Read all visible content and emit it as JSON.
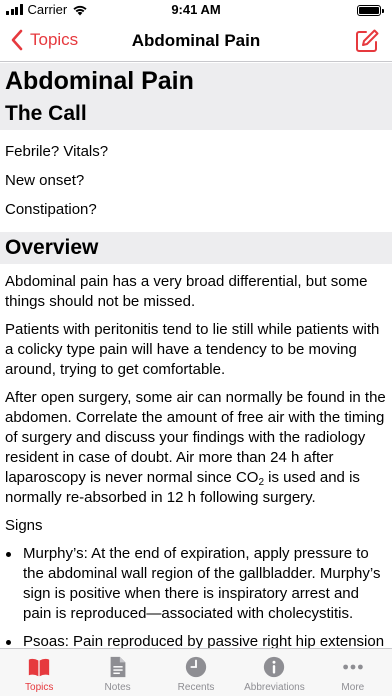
{
  "status_bar": {
    "carrier": "Carrier",
    "time": "9:41 AM"
  },
  "nav": {
    "back_label": "Topics",
    "title": "Abdominal Pain"
  },
  "article": {
    "title": "Abdominal Pain",
    "call_heading": "The Call",
    "call_questions": [
      "Febrile? Vitals?",
      "New onset?",
      "Constipation?"
    ],
    "overview_heading": "Overview",
    "paragraphs": [
      "Abdominal pain has a very broad differential, but some things should not be missed.",
      "Patients with peritonitis tend to lie still while patients with a colicky type pain will have a tendency to be moving around, trying to get comfortable."
    ],
    "surgery_para_before_sub": "After open surgery, some air can normally be found in the abdomen. Correlate the amount of free air with the timing of surgery and discuss your findings with the radiology resident in case of doubt. Air more than 24 h after laparoscopy is never normal since CO",
    "surgery_para_sub": "2",
    "surgery_para_after_sub": " is used and is normally re-absorbed in 12 h following surgery.",
    "signs_label": "Signs",
    "signs": [
      "Murphy’s: At the end of expiration, apply pressure to the abdominal wall region of the gallbladder. Murphy’s sign is positive when there is inspiratory arrest and pain is reproduced—associated with cholecystitis.",
      "Psoas: Pain reproduced by passive right hip extension with knee extended (patient prone or on"
    ]
  },
  "tabs": [
    {
      "label": "Topics",
      "icon": "book-icon",
      "active": true
    },
    {
      "label": "Notes",
      "icon": "document-icon",
      "active": false
    },
    {
      "label": "Recents",
      "icon": "clock-icon",
      "active": false
    },
    {
      "label": "Abbreviations",
      "icon": "info-icon",
      "active": false
    },
    {
      "label": "More",
      "icon": "ellipsis-icon",
      "active": false
    }
  ],
  "colors": {
    "accent": "#e6393e",
    "inactive": "#8e8e93",
    "section_background": "#ededef"
  }
}
